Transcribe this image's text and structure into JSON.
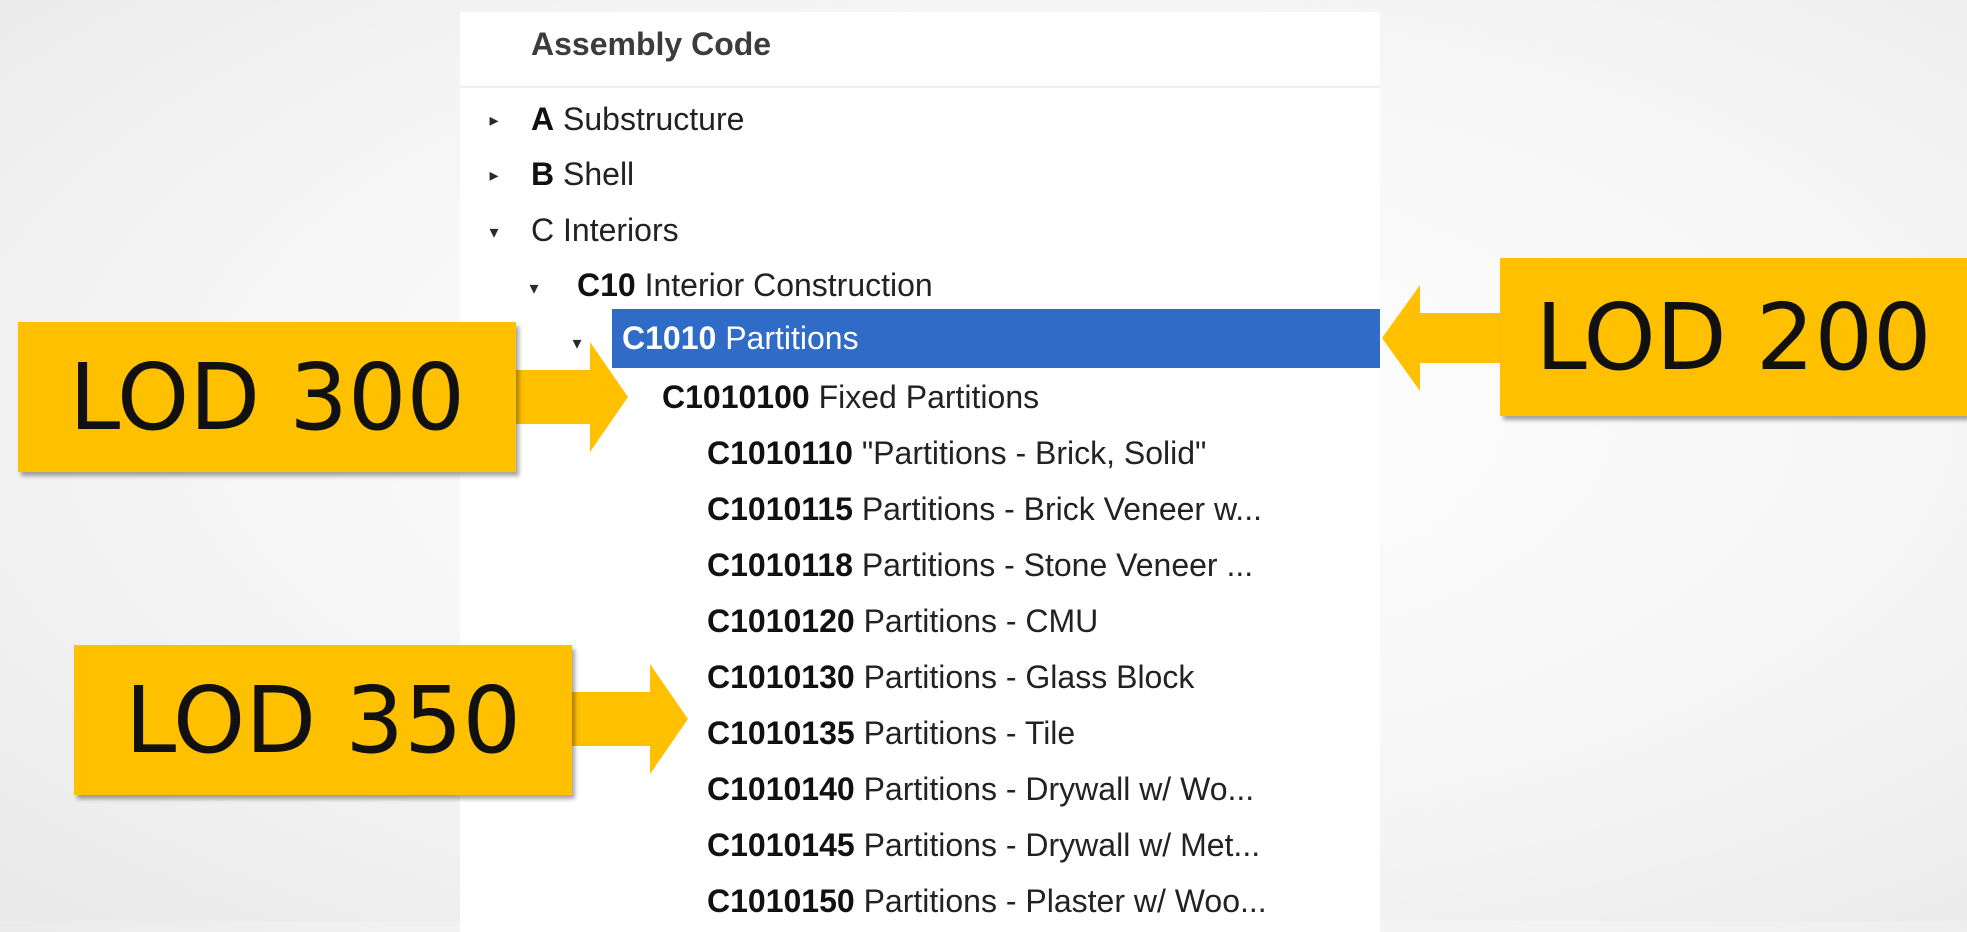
{
  "tree": {
    "header": "Assembly Code",
    "items": [
      {
        "code": "A",
        "label": "Substructure",
        "state": "collapsed"
      },
      {
        "code": "B",
        "label": "Shell",
        "state": "collapsed"
      },
      {
        "code": "C",
        "label": "Interiors",
        "state": "expanded"
      },
      {
        "code": "C10",
        "label": "Interior Construction",
        "state": "expanded"
      },
      {
        "code": "C1010",
        "label": "Partitions",
        "state": "expanded",
        "selected": true
      },
      {
        "code": "C1010100",
        "label": "Fixed Partitions",
        "state": "expanded"
      },
      {
        "code": "C1010110",
        "label": "\"Partitions - Brick, Solid\""
      },
      {
        "code": "C1010115",
        "label": "Partitions - Brick Veneer w..."
      },
      {
        "code": "C1010118",
        "label": "Partitions - Stone Veneer ..."
      },
      {
        "code": "C1010120",
        "label": "Partitions - CMU"
      },
      {
        "code": "C1010130",
        "label": "Partitions - Glass Block"
      },
      {
        "code": "C1010135",
        "label": "Partitions - Tile"
      },
      {
        "code": "C1010140",
        "label": "Partitions - Drywall w/ Wo..."
      },
      {
        "code": "C1010145",
        "label": "Partitions - Drywall w/ Met..."
      },
      {
        "code": "C1010150",
        "label": "Partitions - Plaster w/ Woo..."
      }
    ]
  },
  "callouts": {
    "lod200": "LOD 200",
    "lod300": "LOD 300",
    "lod350": "LOD 350"
  },
  "colors": {
    "callout": "#ffc000",
    "selection": "#2f6bc7",
    "background": "#f4f4f4"
  },
  "icons": {
    "collapsed": "triangle-right-icon",
    "expanded": "triangle-down-icon",
    "arrow": "arrow-icon"
  }
}
